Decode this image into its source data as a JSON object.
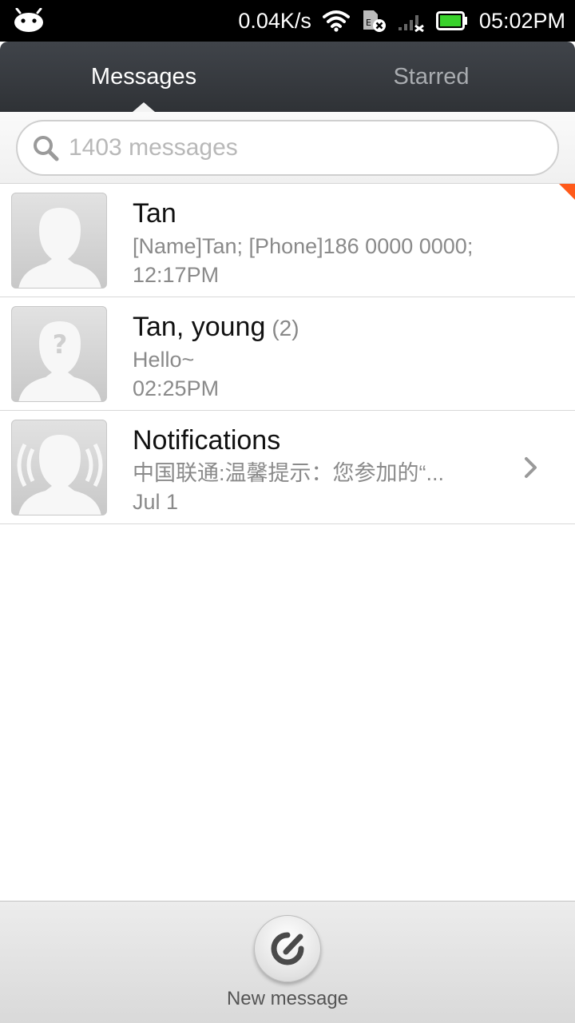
{
  "status_bar": {
    "network_speed": "0.04K/s",
    "time": "05:02PM",
    "battery_color": "#39d12c",
    "icons": [
      "android-icon",
      "wifi-icon",
      "sim-error-icon",
      "signal-no-service-icon",
      "battery-icon"
    ]
  },
  "tabs": [
    {
      "label": "Messages",
      "active": true
    },
    {
      "label": "Starred",
      "active": false
    }
  ],
  "search": {
    "placeholder": "1403 messages",
    "value": ""
  },
  "conversations": [
    {
      "name": "Tan",
      "count": "",
      "snippet": "[Name]Tan; [Phone]186 0000 0000;",
      "time": "12:17PM",
      "avatar": "contact-avatar-icon",
      "unread": true
    },
    {
      "name": "Tan, young",
      "count": "(2)",
      "snippet": "Hello~",
      "time": "02:25PM",
      "avatar": "unknown-contact-avatar-icon",
      "unread": false
    },
    {
      "name": "Notifications",
      "count": "",
      "snippet": "中国联通:温馨提示：您参加的“...",
      "time": "Jul 1",
      "avatar": "notifications-avatar-icon",
      "unread": false
    }
  ],
  "bottom_bar": {
    "new_message_label": "New message"
  },
  "colors": {
    "accent_unread": "#ff5a1a",
    "header_bg": "#2f3236"
  }
}
